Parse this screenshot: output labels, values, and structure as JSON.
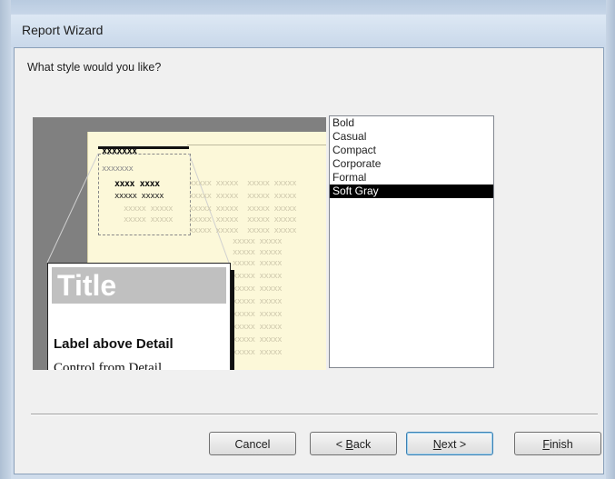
{
  "window": {
    "title": "Report Wizard"
  },
  "prompt": "What style would you like?",
  "preview": {
    "header_mark": "xxxxxxx",
    "sub_mark": "xxxxxxx",
    "group_mark": "xxxx xxxx",
    "detail_mark": "xxxxx xxxxx",
    "filler_mark": "xxxxx xxxxx",
    "title": "Title",
    "label": "Label above Detail",
    "control": "Control from Detail"
  },
  "styles": {
    "items": [
      "Bold",
      "Casual",
      "Compact",
      "Corporate",
      "Formal",
      "Soft Gray"
    ],
    "selected": "Soft Gray"
  },
  "buttons": {
    "cancel": "Cancel",
    "back_prefix": "< ",
    "back_key": "B",
    "back_rest": "ack",
    "next_key": "N",
    "next_rest": "ext >",
    "finish_key": "F",
    "finish_rest": "inish"
  }
}
